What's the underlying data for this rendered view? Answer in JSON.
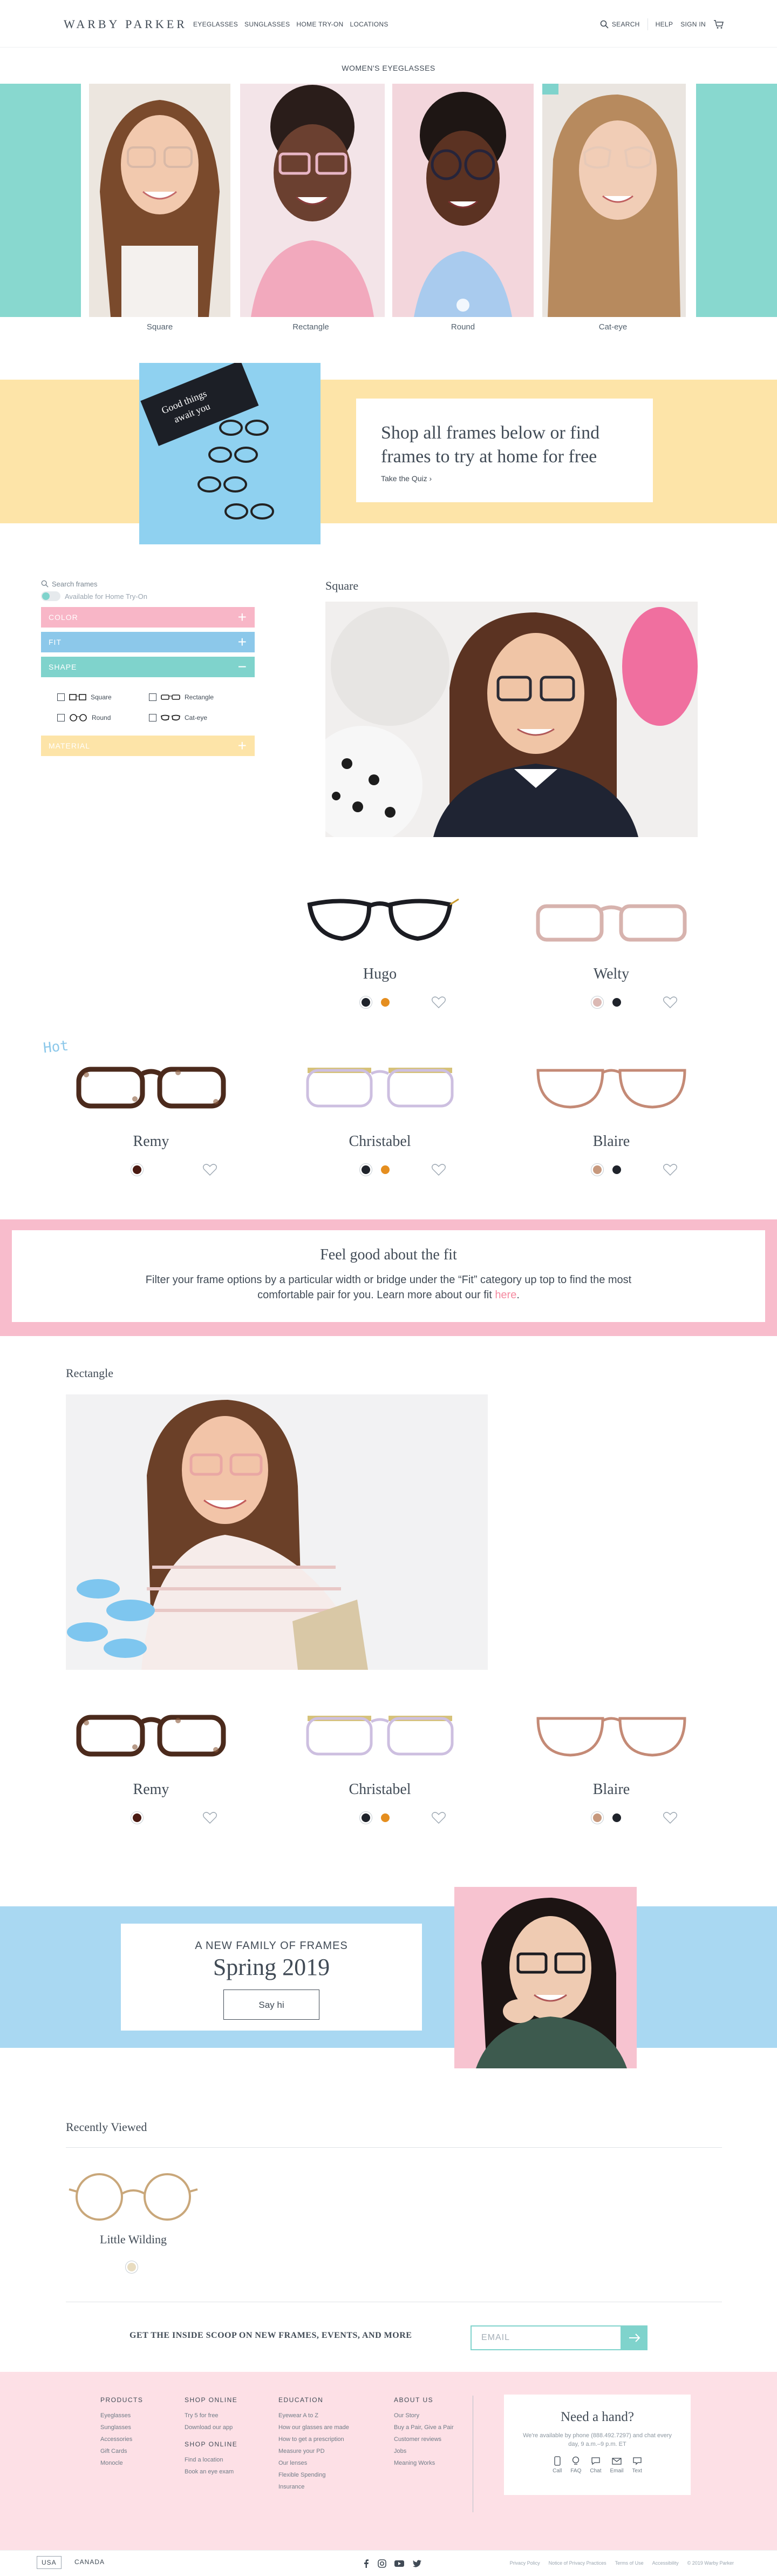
{
  "header": {
    "logo": "WARBY PARKER",
    "nav": [
      "EYEGLASSES",
      "SUNGLASSES",
      "HOME TRY-ON",
      "LOCATIONS"
    ],
    "search": "SEARCH",
    "help": "HELP",
    "signin": "SIGN IN"
  },
  "page_title": "WOMEN'S EYEGLASSES",
  "shapes": [
    "Square",
    "Rectangle",
    "Round",
    "Cat-eye"
  ],
  "quiz": {
    "box_text": "Good things await you",
    "title": "Shop all frames below or find frames to try at home for free",
    "link": "Take the Quiz"
  },
  "filters": {
    "search_placeholder": "Search frames",
    "home_try_on": "Available for Home Try-On",
    "sections": [
      "COLOR",
      "FIT",
      "SHAPE",
      "MATERIAL"
    ],
    "shape_options": [
      "Square",
      "Rectangle",
      "Round",
      "Cat-eye"
    ]
  },
  "sections": {
    "square": "Square",
    "rectangle": "Rectangle",
    "recent": "Recently Viewed"
  },
  "products_square": [
    {
      "name": "Hugo",
      "colors": [
        "#1f232b",
        "#e58e1f"
      ]
    },
    {
      "name": "Welty",
      "colors": [
        "#dbb9b4",
        "#1f232b"
      ]
    },
    {
      "name": "Remy",
      "colors": [
        "#4a1a12"
      ]
    },
    {
      "name": "Christabel",
      "colors": [
        "#1f232b",
        "#e58e1f"
      ]
    },
    {
      "name": "Blaire",
      "colors": [
        "#c7997e",
        "#1f232b"
      ]
    }
  ],
  "hot_badge": "Hot",
  "fit_banner": {
    "title": "Feel good about the fit",
    "body": "Filter your frame options by a particular width or bridge under the “Fit” category up top to find the most comfortable pair for you. Learn more about our fit",
    "link": "here"
  },
  "products_rect": [
    {
      "name": "Remy",
      "colors": [
        "#4a1a12"
      ]
    },
    {
      "name": "Christabel",
      "colors": [
        "#1f232b",
        "#e58e1f"
      ]
    },
    {
      "name": "Blaire",
      "colors": [
        "#c7997e",
        "#1f232b"
      ]
    }
  ],
  "spring": {
    "small": "A NEW FAMILY OF FRAMES",
    "big": "Spring 2019",
    "button": "Say hi"
  },
  "recent": [
    {
      "name": "Little Wilding",
      "colors": [
        "#e8dcc0"
      ]
    }
  ],
  "newsletter": {
    "text": "GET THE INSIDE SCOOP ON NEW FRAMES, EVENTS, AND MORE",
    "placeholder": "EMAIL"
  },
  "footer": {
    "products": {
      "title": "PRODUCTS",
      "items": [
        "Eyeglasses",
        "Sunglasses",
        "Accessories",
        "Gift Cards",
        "Monocle"
      ]
    },
    "shop_online": {
      "title": "SHOP ONLINE",
      "items": [
        "Try 5 for free",
        "Download our app"
      ]
    },
    "shop_online2": {
      "title": "SHOP ONLINE",
      "items": [
        "Find a location",
        "Book an eye exam"
      ]
    },
    "education": {
      "title": "EDUCATION",
      "items": [
        "Eyewear A to Z",
        "How our glasses are made",
        "How to get a prescription",
        "Measure your PD",
        "Our lenses",
        "Flexible Spending",
        "Insurance"
      ]
    },
    "about": {
      "title": "ABOUT US",
      "items": [
        "Our Story",
        "Buy a Pair, Give a Pair",
        "Customer reviews",
        "Jobs",
        "Meaning Works"
      ]
    },
    "help": {
      "title": "Need a hand?",
      "text": "We're available by phone (888.492.7297) and chat every day, 9 a.m.–9 p.m. ET",
      "icons": [
        "Call",
        "FAQ",
        "Chat",
        "Email",
        "Text"
      ]
    }
  },
  "bottom": {
    "countries": [
      "USA",
      "CANADA"
    ],
    "legal": [
      "Privacy Policy",
      "Notice of Privacy Practices",
      "Terms of Use",
      "Accessibility",
      "© 2019 Warby Parker"
    ]
  },
  "colors": {
    "teal": "#7fd3cc",
    "blue": "#8cc8ea",
    "pink": "#f5a9bb",
    "yellow": "#fde4a8"
  }
}
